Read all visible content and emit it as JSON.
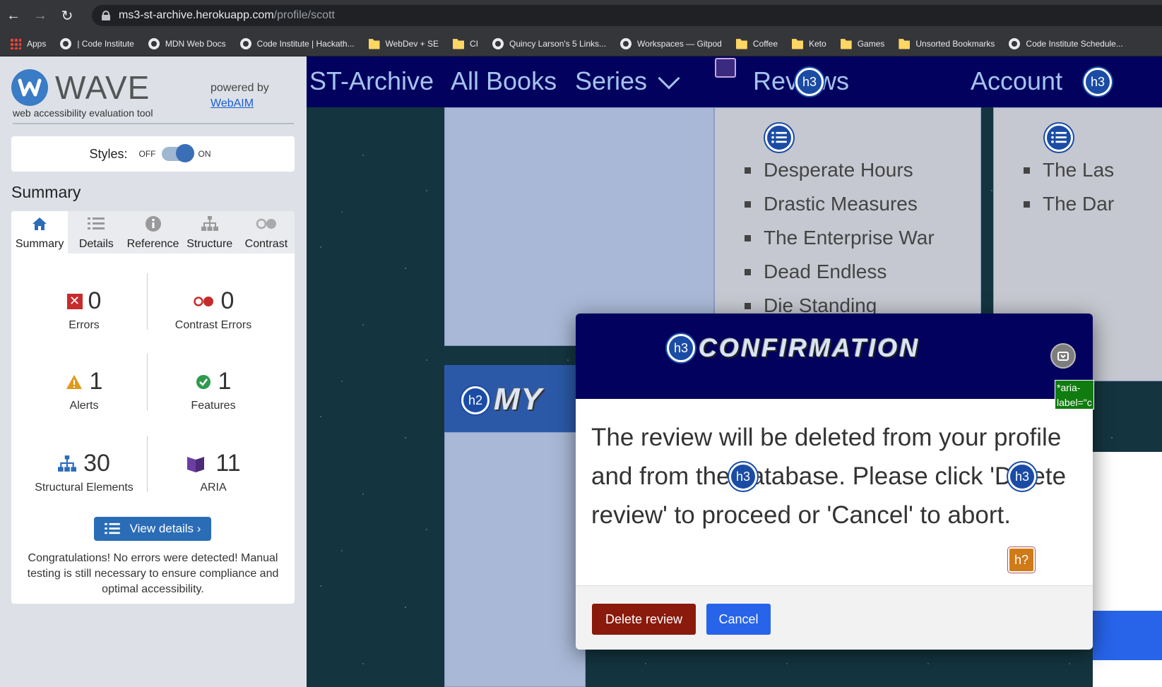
{
  "browser": {
    "url_host": "ms3-st-archive.herokuapp.com",
    "url_path": "/profile/scott",
    "bookmarks": [
      {
        "label": "Apps",
        "icon": "apps-grid-icon"
      },
      {
        "label": "| Code Institute",
        "icon": "globe-icon"
      },
      {
        "label": "MDN Web Docs",
        "icon": "globe-icon"
      },
      {
        "label": "Code Institute | Hackath...",
        "icon": "globe-icon"
      },
      {
        "label": "WebDev + SE",
        "icon": "folder-icon"
      },
      {
        "label": "CI",
        "icon": "folder-icon"
      },
      {
        "label": "Quincy Larson's 5 Links...",
        "icon": "globe-icon"
      },
      {
        "label": "Workspaces — Gitpod",
        "icon": "globe-icon"
      },
      {
        "label": "Coffee",
        "icon": "folder-icon"
      },
      {
        "label": "Keto",
        "icon": "folder-icon"
      },
      {
        "label": "Games",
        "icon": "folder-icon"
      },
      {
        "label": "Unsorted Bookmarks",
        "icon": "folder-icon"
      },
      {
        "label": "Code Institute Schedule...",
        "icon": "globe-icon"
      }
    ]
  },
  "wave": {
    "logo_text": "WAVE",
    "tagline": "web accessibility evaluation tool",
    "powered_by": "powered by",
    "powered_link": "WebAIM",
    "styles_label": "Styles:",
    "styles_off": "OFF",
    "styles_on": "ON",
    "summary_heading": "Summary",
    "tabs": [
      "Summary",
      "Details",
      "Reference",
      "Structure",
      "Contrast"
    ],
    "stats": {
      "errors": {
        "value": "0",
        "label": "Errors"
      },
      "contrast": {
        "value": "0",
        "label": "Contrast Errors"
      },
      "alerts": {
        "value": "1",
        "label": "Alerts"
      },
      "features": {
        "value": "1",
        "label": "Features"
      },
      "structural": {
        "value": "30",
        "label": "Structural Elements"
      },
      "aria": {
        "value": "11",
        "label": "ARIA"
      }
    },
    "view_details": "View details ›",
    "congrats": "Congratulations! No errors were detected! Manual testing is still necessary to ensure compliance and optimal accessibility."
  },
  "site": {
    "nav": {
      "brand": "ST-Archive",
      "all_books": "All Books",
      "series": "Series",
      "reviews": "Reviews",
      "account": "Account"
    },
    "list_a": [
      "Desperate Hours",
      "Drastic Measures",
      "The Enterprise War",
      "Dead Endless",
      "Die Standing"
    ],
    "list_b": [
      "The Las",
      "The Dar"
    ],
    "my_heading": "MY",
    "badges": {
      "h3": "h3",
      "h2": "h2",
      "h_alert": "h?"
    },
    "aria_tag": "*aria-\nlabel=\"c"
  },
  "modal": {
    "title": "CONFIRMATION",
    "body": "The review will be deleted from your profile and from the database. Please click 'Delete review' to proceed or 'Cancel' to abort.",
    "delete_label": "Delete review",
    "cancel_label": "Cancel"
  },
  "colors": {
    "navbar": "#02025e",
    "wave_blue": "#2b6cb7",
    "delete": "#8a1a0c",
    "cancel": "#2764ea"
  }
}
